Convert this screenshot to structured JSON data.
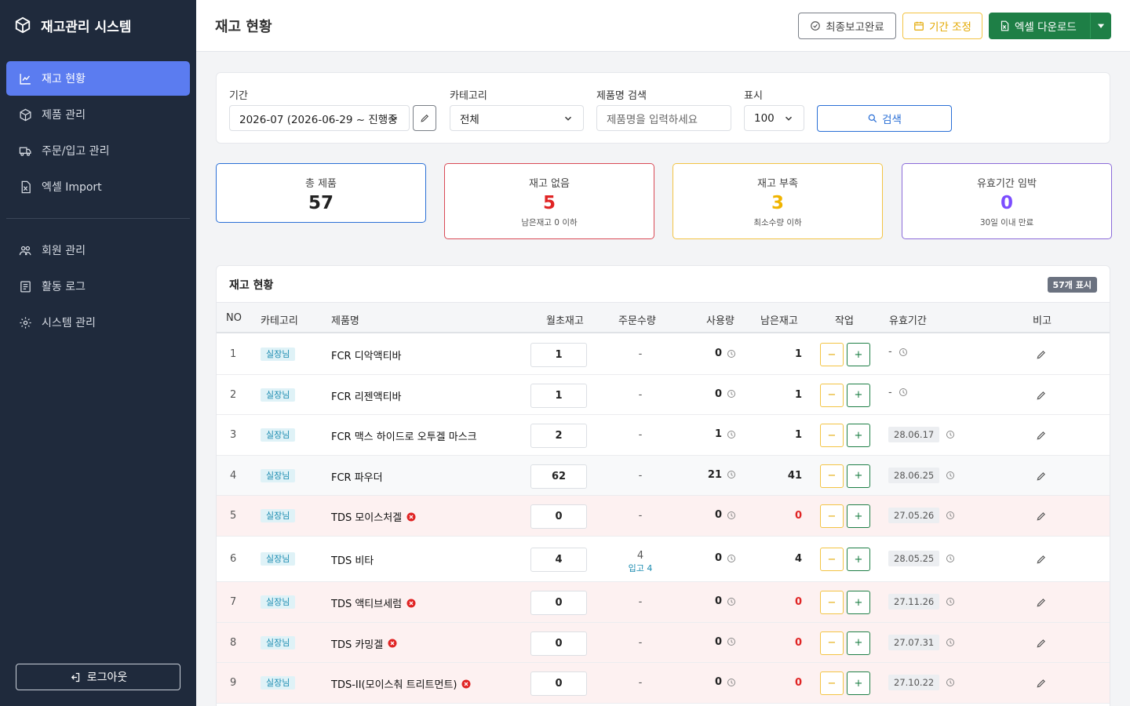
{
  "app": {
    "title": "재고관리 시스템",
    "logout": "로그아웃"
  },
  "sidebar": {
    "items": [
      {
        "label": "재고 현황",
        "icon": "chart-line-icon",
        "active": true
      },
      {
        "label": "제품 관리",
        "icon": "box-icon"
      },
      {
        "label": "주문/입고 관리",
        "icon": "truck-icon"
      },
      {
        "label": "엑셀 Import",
        "icon": "excel-file-icon"
      }
    ],
    "items2": [
      {
        "label": "회원 관리",
        "icon": "users-icon"
      },
      {
        "label": "활동 로그",
        "icon": "log-icon"
      },
      {
        "label": "시스템 관리",
        "icon": "gear-icon"
      }
    ]
  },
  "header": {
    "title": "재고 현황",
    "final_report": "최종보고완료",
    "period_adjust": "기간 조정",
    "excel_download": "엑셀 다운로드"
  },
  "filters": {
    "period_label": "기간",
    "period_value": "2026-07 (2026-06-29 ~ 진행중",
    "category_label": "카테고리",
    "category_value": "전체",
    "search_label": "제품명 검색",
    "search_placeholder": "제품명을 입력하세요",
    "display_label": "표시",
    "display_value": "100",
    "search_button": "검색"
  },
  "stats": [
    {
      "label": "총 제품",
      "value": "57",
      "sub": "",
      "color": "#222222",
      "border": "#2a6fd6"
    },
    {
      "label": "재고 없음",
      "value": "5",
      "sub": "남은재고 0 이하",
      "color": "#e02424",
      "border": "#d94a56"
    },
    {
      "label": "재고 부족",
      "value": "3",
      "sub": "최소수량 이하",
      "color": "#f0b400",
      "border": "#f3c444"
    },
    {
      "label": "유효기간 임박",
      "value": "0",
      "sub": "30일 이내 만료",
      "color": "#7c4dff",
      "border": "#8b6bd9"
    }
  ],
  "table": {
    "title": "재고 현황",
    "badge": "57개 표시",
    "headers": [
      "NO",
      "카테고리",
      "제품명",
      "월초재고",
      "주문수량",
      "사용량",
      "남은재고",
      "작업",
      "유효기간",
      "비고"
    ],
    "rows": [
      {
        "no": "1",
        "cat": "실장님",
        "name": "FCR 디악액티바",
        "init": "1",
        "order": "-",
        "order_in": "",
        "usage": "0",
        "remain": "1",
        "expiry": "-",
        "flag": false
      },
      {
        "no": "2",
        "cat": "실장님",
        "name": "FCR 리젠액티바",
        "init": "1",
        "order": "-",
        "order_in": "",
        "usage": "0",
        "remain": "1",
        "expiry": "-",
        "flag": false
      },
      {
        "no": "3",
        "cat": "실장님",
        "name": "FCR 맥스 하이드로 오투겔 마스크",
        "init": "2",
        "order": "-",
        "order_in": "",
        "usage": "1",
        "remain": "1",
        "expiry": "28.06.17",
        "flag": false
      },
      {
        "no": "4",
        "cat": "실장님",
        "name": "FCR 파우더",
        "init": "62",
        "order": "-",
        "order_in": "",
        "usage": "21",
        "remain": "41",
        "expiry": "28.06.25",
        "flag": false
      },
      {
        "no": "5",
        "cat": "실장님",
        "name": "TDS 모이스처겔",
        "init": "0",
        "order": "-",
        "order_in": "",
        "usage": "0",
        "remain": "0",
        "expiry": "27.05.26",
        "flag": true
      },
      {
        "no": "6",
        "cat": "실장님",
        "name": "TDS 비타",
        "init": "4",
        "order": "4",
        "order_in": "입고 4",
        "usage": "0",
        "remain": "4",
        "expiry": "28.05.25",
        "flag": false
      },
      {
        "no": "7",
        "cat": "실장님",
        "name": "TDS 액티브세럼",
        "init": "0",
        "order": "-",
        "order_in": "",
        "usage": "0",
        "remain": "0",
        "expiry": "27.11.26",
        "flag": true
      },
      {
        "no": "8",
        "cat": "실장님",
        "name": "TDS 카밍겔",
        "init": "0",
        "order": "-",
        "order_in": "",
        "usage": "0",
        "remain": "0",
        "expiry": "27.07.31",
        "flag": true
      },
      {
        "no": "9",
        "cat": "실장님",
        "name": "TDS-II(모이스춰 트리트먼트)",
        "init": "0",
        "order": "-",
        "order_in": "",
        "usage": "0",
        "remain": "0",
        "expiry": "27.10.22",
        "flag": true
      }
    ]
  }
}
